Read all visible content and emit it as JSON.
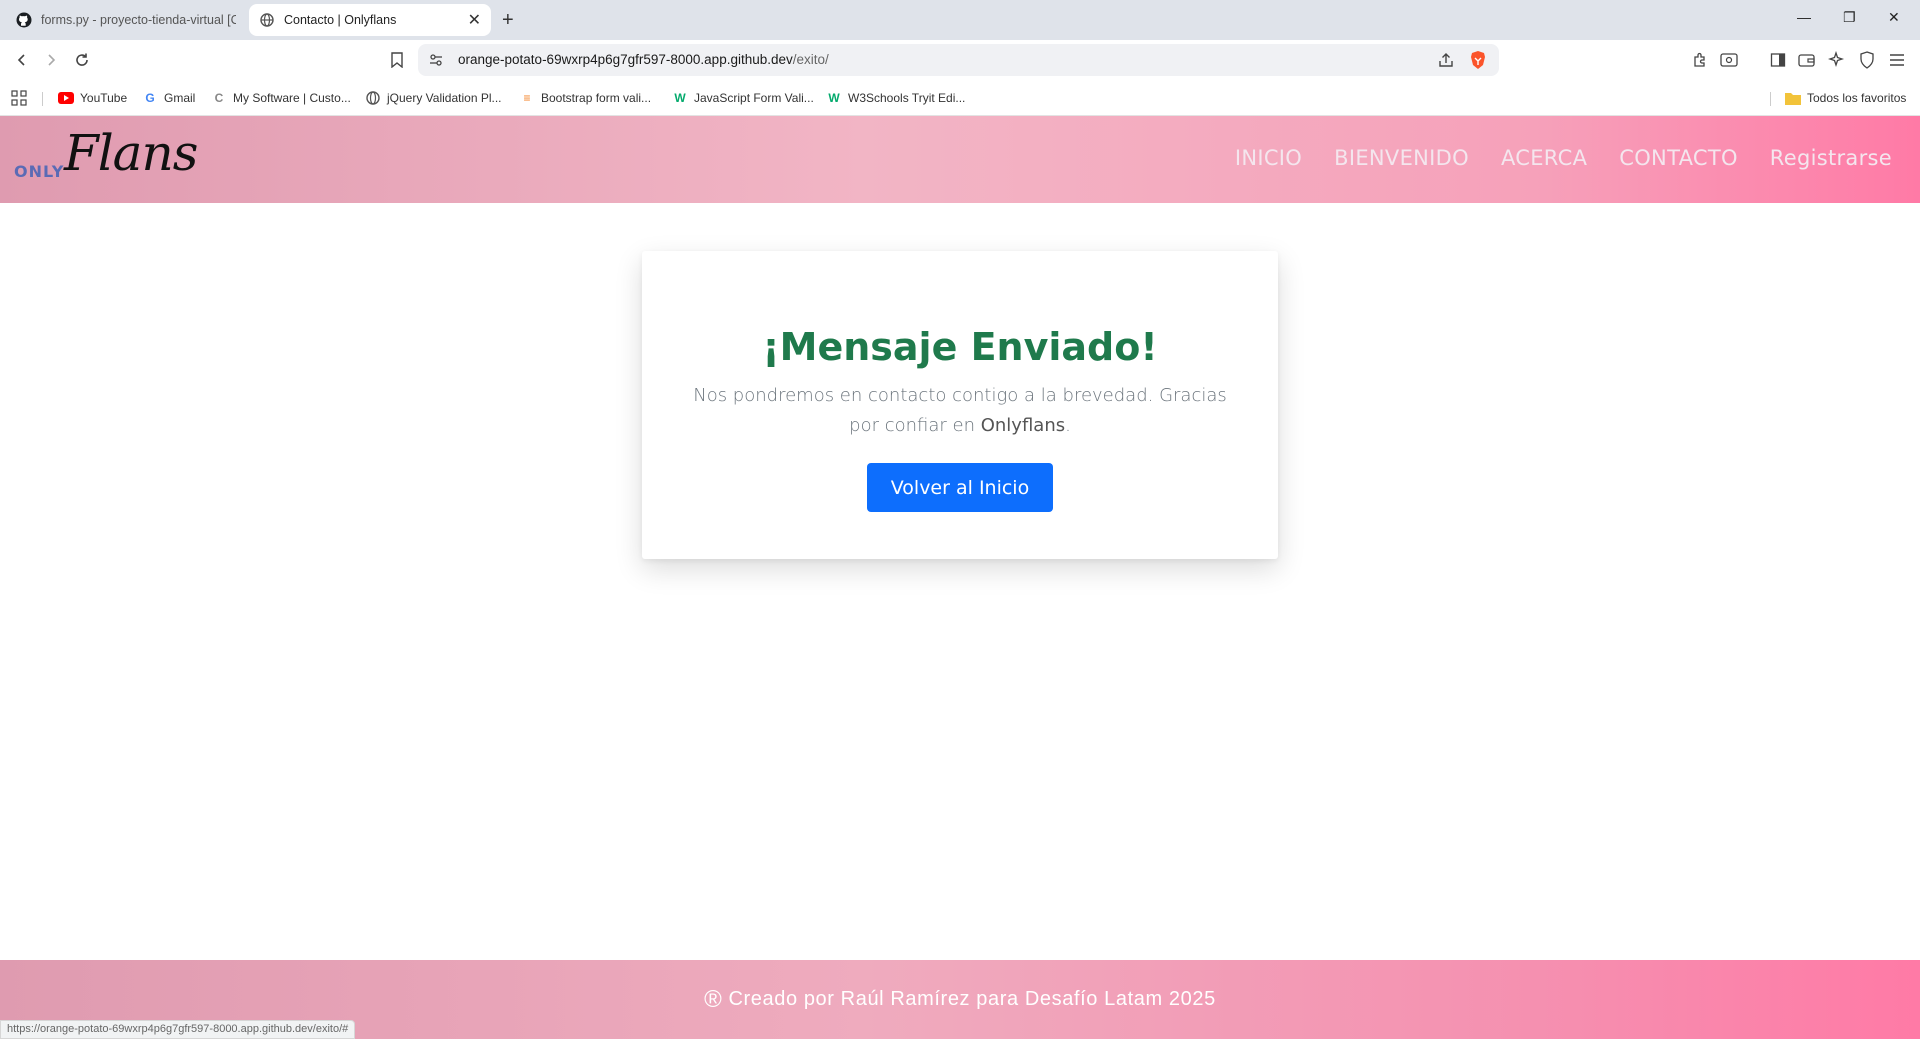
{
  "browser": {
    "tabs": [
      {
        "title": "forms.py - proyecto-tienda-virtual [C",
        "icon": "github-icon"
      },
      {
        "title": "Contacto | Onlyflans",
        "icon": "globe-icon",
        "close": "✕"
      }
    ],
    "new_tab": "+",
    "window_controls": {
      "minimize": "—",
      "restore": "❐",
      "close": "✕"
    },
    "url_host": "orange-potato-69wxrp4p6g7gfr597-8000.app.github.dev",
    "url_path": "/exito/",
    "bookmarks": [
      {
        "label": "YouTube",
        "icon": "youtube-icon"
      },
      {
        "label": "Gmail",
        "icon": "google-icon"
      },
      {
        "label": "My Software | Custo...",
        "icon": "c-icon"
      },
      {
        "label": "jQuery Validation Pl...",
        "icon": "globe-icon"
      },
      {
        "label": "Bootstrap form vali...",
        "icon": "stackoverflow-icon"
      },
      {
        "label": "JavaScript Form Vali...",
        "icon": "w3schools-icon"
      },
      {
        "label": "W3Schools Tryit Edi...",
        "icon": "w3schools-icon"
      }
    ],
    "all_bookmarks": "Todos los favoritos",
    "status_url": "https://orange-potato-69wxrp4p6g7gfr597-8000.app.github.dev/exito/#"
  },
  "site": {
    "logo_only": "ONLY",
    "logo_flans": "Flans",
    "nav": [
      "INICIO",
      "BIENVENIDO",
      "ACERCA",
      "CONTACTO",
      "Registrarse"
    ],
    "colors": {
      "title_green": "#1f7a4c",
      "button_blue": "#0d6efd",
      "nav_pink": "#ff7aa6"
    }
  },
  "card": {
    "title": "¡Mensaje Enviado!",
    "text_before": "Nos pondremos en contacto contigo a la brevedad. Gracias por confiar en ",
    "brand": "Onlyflans",
    "text_after": ".",
    "button": "Volver al Inicio"
  },
  "footer": {
    "symbol": "®",
    "text": "Creado por Raúl Ramírez para Desafío Latam 2025"
  }
}
